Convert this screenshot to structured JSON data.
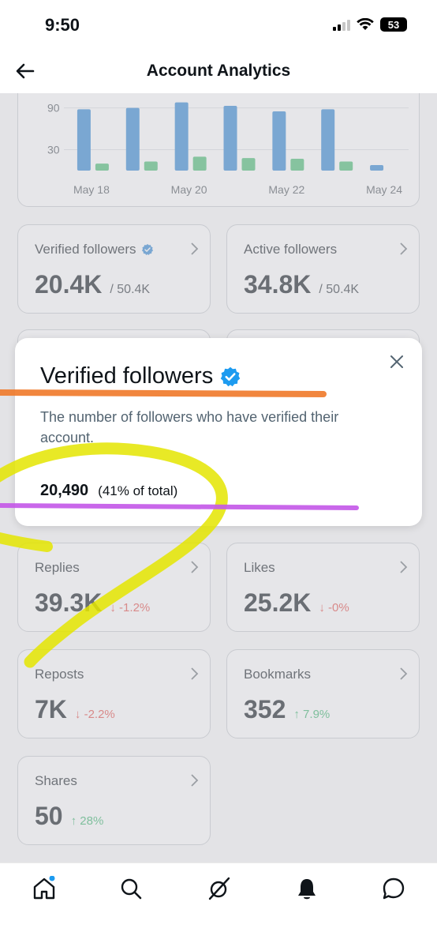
{
  "status_bar": {
    "time": "9:50",
    "battery": "53"
  },
  "header": {
    "title": "Account Analytics"
  },
  "chart_data": {
    "type": "bar",
    "categories": [
      "May 18",
      "May 19",
      "May 20",
      "May 21",
      "May 22",
      "May 23",
      "May 24"
    ],
    "x_tick_labels": [
      "May 18",
      "May 20",
      "May 22",
      "May 24"
    ],
    "y_tick_labels": [
      "90",
      "30"
    ],
    "series": [
      {
        "values": [
          88,
          90,
          98,
          93,
          85,
          88,
          8
        ]
      },
      {
        "values": [
          10,
          13,
          20,
          18,
          17,
          13,
          0
        ]
      }
    ],
    "series_colors": [
      "#7aa7d2",
      "#86c39f"
    ],
    "ylim": [
      0,
      110
    ],
    "grid": true
  },
  "cards": [
    {
      "id": "verified",
      "label": "Verified followers",
      "value": "20.4K",
      "sub": "/ 50.4K",
      "verified_icon": true
    },
    {
      "id": "active",
      "label": "Active followers",
      "value": "34.8K",
      "sub": "/ 50.4K"
    },
    {
      "id": "replies",
      "label": "Replies",
      "value": "39.3K",
      "change": "↓ -1.2%",
      "trend": "down"
    },
    {
      "id": "likes",
      "label": "Likes",
      "value": "25.2K",
      "change": "↓ -0%",
      "trend": "down"
    },
    {
      "id": "reposts",
      "label": "Reposts",
      "value": "7K",
      "change": "↓ -2.2%",
      "trend": "down"
    },
    {
      "id": "bookmarks",
      "label": "Bookmarks",
      "value": "352",
      "change": "↑ 7.9%",
      "trend": "up"
    },
    {
      "id": "shares",
      "label": "Shares",
      "value": "50",
      "change": "↑ 28%",
      "trend": "up"
    }
  ],
  "popup": {
    "title": "Verified followers",
    "description": "The number of followers who have verified their account.",
    "count": "20,490",
    "percent": "(41% of total)"
  },
  "tabs": [
    "home-icon",
    "search-icon",
    "grok-icon",
    "notifications-icon",
    "messages-icon"
  ],
  "colors": {
    "accent": "#1d9bf0",
    "annotation_orange": "#f07a2a",
    "annotation_purple": "#c457e8",
    "annotation_yellow": "#e4e500"
  }
}
